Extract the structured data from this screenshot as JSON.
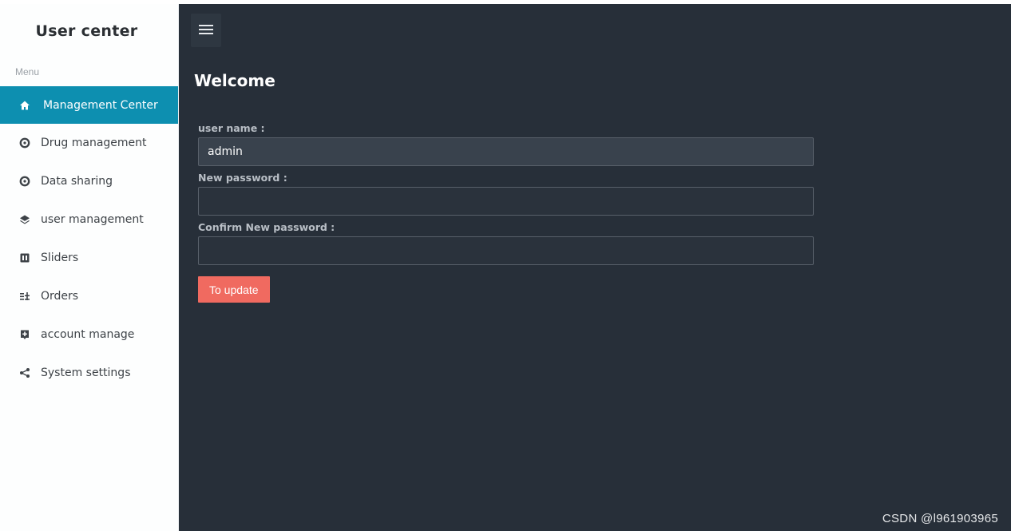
{
  "sidebar": {
    "brand": "User center",
    "menu_caption": "Menu",
    "items": [
      {
        "label": "Management Center",
        "icon": "home-icon",
        "active": true
      },
      {
        "label": "Drug management",
        "icon": "circle-dot-icon"
      },
      {
        "label": "Data sharing",
        "icon": "circle-dot-icon"
      },
      {
        "label": "user management",
        "icon": "layers-icon"
      },
      {
        "label": "Sliders",
        "icon": "slider-box-icon"
      },
      {
        "label": "Orders",
        "icon": "orders-icon"
      },
      {
        "label": "account manage",
        "icon": "add-box-icon"
      },
      {
        "label": "System settings",
        "icon": "share-icon"
      }
    ]
  },
  "header": {
    "menu_toggle_icon": "hamburger-icon"
  },
  "main": {
    "title": "Welcome",
    "form": {
      "username_label": "user name :",
      "username_value": "admin",
      "new_password_label": "New password :",
      "new_password_value": "",
      "confirm_password_label": "Confirm New password :",
      "confirm_password_value": "",
      "submit_label": "To update"
    }
  },
  "watermark": "CSDN @l961903965",
  "colors": {
    "accent": "#0d8fb0",
    "main_bg": "#272f39",
    "submit": "#f06a60"
  }
}
